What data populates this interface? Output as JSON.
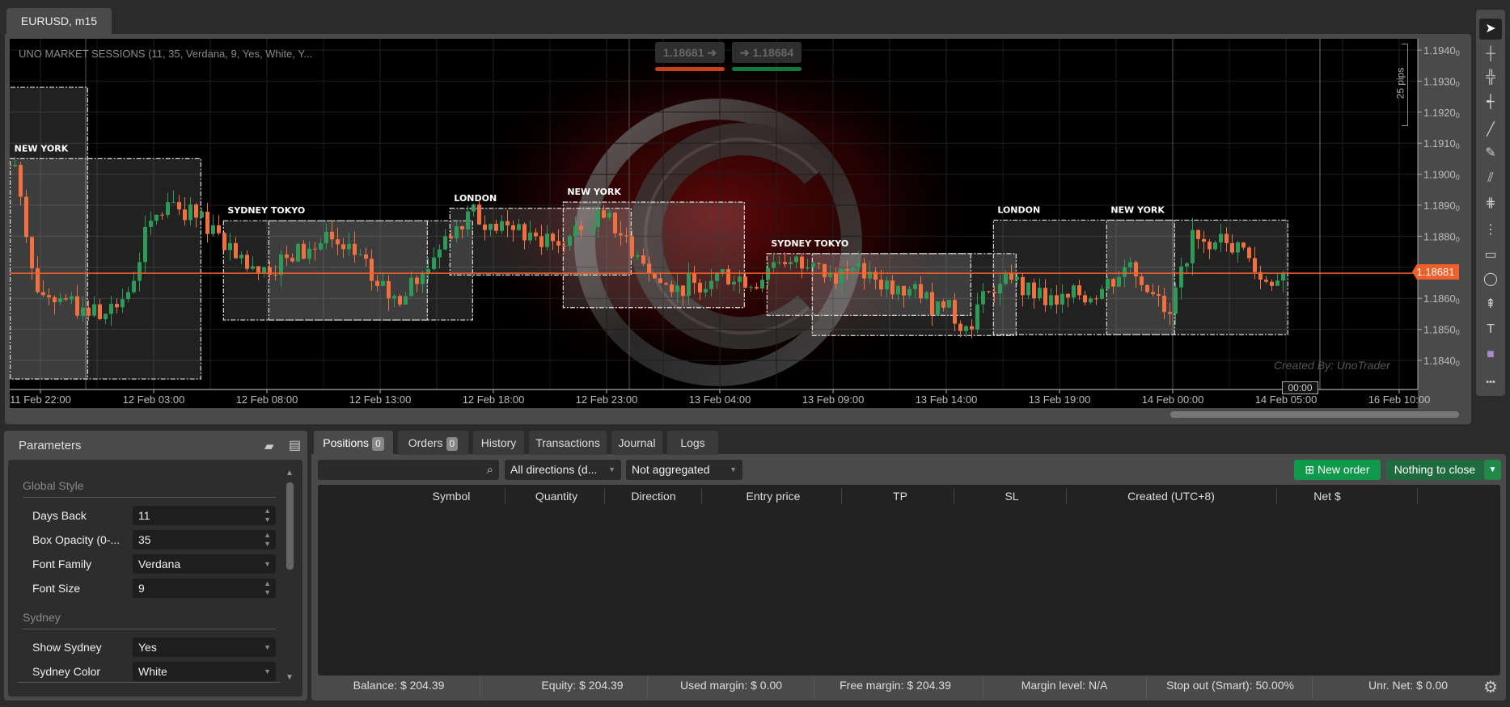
{
  "window_tab": "EURUSD, m15",
  "chart": {
    "indicator_title": "UNO MARKET SESSIONS (11, 35, Verdana, 9, Yes, White, Y...",
    "bid": "1.18681",
    "ask": "1.18684",
    "current_price_tag": "1.18681",
    "ruler_label": "25 pips",
    "watermark_text": "Created By: UnoTrader",
    "candle_timer": "00:00",
    "colors": {
      "bull": "#2f9a58",
      "bear": "#f07040",
      "price_line": "#f0602a",
      "bid_bar": "#c8401e",
      "ask_bar": "#0f7a3a"
    }
  },
  "chart_data": {
    "type": "candlestick",
    "symbol": "EURUSD",
    "timeframe": "m15",
    "ylim": [
      1.1835,
      1.1945
    ],
    "y_ticks": [
      "1.19400",
      "1.19300",
      "1.19200",
      "1.19100",
      "1.19000",
      "1.18900",
      "1.18800",
      "1.18700",
      "1.18600",
      "1.18500",
      "1.18400"
    ],
    "x_ticks": [
      "11 Feb 22:00",
      "12 Feb 03:00",
      "12 Feb 08:00",
      "12 Feb 13:00",
      "12 Feb 18:00",
      "12 Feb 23:00",
      "13 Feb 04:00",
      "13 Feb 09:00",
      "13 Feb 14:00",
      "13 Feb 19:00",
      "14 Feb 00:00",
      "14 Feb 05:00",
      "16 Feb 10:00"
    ],
    "grid": true,
    "hourly_close_start": "11 Feb 21:00",
    "hourly_close": [
      1.1903,
      1.1862,
      1.186,
      1.1857,
      1.1855,
      1.1862,
      1.1885,
      1.1891,
      1.1886,
      1.1881,
      1.1874,
      1.187,
      1.1873,
      1.1876,
      1.1879,
      1.1874,
      1.1864,
      1.1858,
      1.1868,
      1.188,
      1.1888,
      1.1884,
      1.1882,
      1.188,
      1.1877,
      1.1882,
      1.1886,
      1.188,
      1.1868,
      1.1862,
      1.1865,
      1.1868,
      1.1867,
      1.1866,
      1.1871,
      1.187,
      1.1868,
      1.187,
      1.1866,
      1.1864,
      1.186,
      1.1857,
      1.1851,
      1.1862,
      1.1866,
      1.186,
      1.1858,
      1.1861,
      1.1863,
      1.187,
      1.1862,
      1.1855,
      1.1882,
      1.1878,
      1.1878,
      1.1866,
      1.18681
    ],
    "current_price": 1.18681,
    "sessions": [
      {
        "label": "",
        "start": "11 Feb 20:15",
        "end": "12 Feb 00:05",
        "high": 1.1928,
        "low": 1.1834
      },
      {
        "label": "NEW YORK",
        "start": "11 Feb 20:40",
        "end": "12 Feb 05:05",
        "high": 1.1905,
        "low": 1.1834
      },
      {
        "label": "SYDNEY TOKYO",
        "start": "12 Feb 06:05",
        "end": "12 Feb 15:05",
        "high": 1.1885,
        "low": 1.1853
      },
      {
        "label": "",
        "start": "12 Feb 08:05",
        "end": "12 Feb 17:05",
        "high": 1.1885,
        "low": 1.1853
      },
      {
        "label": "LONDON",
        "start": "12 Feb 16:05",
        "end": "13 Feb 00:05",
        "high": 1.1889,
        "low": 1.18675
      },
      {
        "label": "NEW YORK",
        "start": "12 Feb 21:05",
        "end": "13 Feb 05:05",
        "high": 1.1891,
        "low": 1.1857
      },
      {
        "label": "SYDNEY TOKYO",
        "start": "13 Feb 06:05",
        "end": "13 Feb 15:05",
        "high": 1.18744,
        "low": 1.18545
      },
      {
        "label": "",
        "start": "13 Feb 08:05",
        "end": "13 Feb 17:05",
        "high": 1.18744,
        "low": 1.1848
      },
      {
        "label": "LONDON",
        "start": "13 Feb 16:05",
        "end": "14 Feb 00:05",
        "high": 1.18852,
        "low": 1.18483
      },
      {
        "label": "NEW YORK",
        "start": "13 Feb 21:05",
        "end": "14 Feb 05:05",
        "high": 1.18852,
        "low": 1.18483
      }
    ],
    "day_separators": [
      "12 Feb 00:00",
      "13 Feb 00:00",
      "14 Feb 00:00"
    ],
    "current_time_line": "14 Feb 06:30"
  },
  "toolbar": [
    "cursor-icon",
    "crosshair-icon",
    "crosshair-magnet-icon",
    "add-point-icon",
    "trendline-icon",
    "pencil-icon",
    "fibonacci-expansion-icon",
    "channel-icon",
    "fibonacci-icon",
    "rectangle-icon",
    "ellipse-icon",
    "price-range-icon",
    "text-icon",
    "color-swatch-icon",
    "more-icon"
  ],
  "toolbar_glyphs": [
    "➤",
    "┼",
    "╬",
    "┽",
    "╱",
    "✎",
    "⫽",
    "⋕",
    "⋮",
    "▭",
    "◯",
    "⇞",
    "T",
    "■",
    "•••"
  ],
  "parameters": {
    "title": "Parameters",
    "groups": [
      {
        "name": "Global Style",
        "rows": [
          {
            "label": "Days Back",
            "value": "11",
            "kind": "number"
          },
          {
            "label": "Box Opacity (0-...",
            "value": "35",
            "kind": "number"
          },
          {
            "label": "Font Family",
            "value": "Verdana",
            "kind": "select"
          },
          {
            "label": "Font Size",
            "value": "9",
            "kind": "number"
          }
        ]
      },
      {
        "name": "Sydney",
        "rows": [
          {
            "label": "Show Sydney",
            "value": "Yes",
            "kind": "select"
          },
          {
            "label": "Sydney Color",
            "value": "White",
            "kind": "select"
          }
        ]
      }
    ]
  },
  "bottom": {
    "tabs": [
      {
        "label": "Positions",
        "badge": "0"
      },
      {
        "label": "Orders",
        "badge": "0"
      },
      {
        "label": "History"
      },
      {
        "label": "Transactions"
      },
      {
        "label": "Journal"
      },
      {
        "label": "Logs"
      }
    ],
    "search_value": "",
    "direction_filter": "All directions (d...",
    "aggregation_filter": "Not aggregated",
    "new_order": "New order",
    "close_button": "Nothing to close",
    "columns": [
      "Symbol",
      "Quantity",
      "Direction",
      "Entry price",
      "TP",
      "SL",
      "Created (UTC+8)",
      "Net $"
    ],
    "footer": [
      {
        "label": "Balance:",
        "value": "$ 204.39"
      },
      {
        "label": "Equity:",
        "value": "$ 204.39"
      },
      {
        "label": "Used margin:",
        "value": "$ 0.00"
      },
      {
        "label": "Free margin:",
        "value": "$ 204.39"
      },
      {
        "label": "Margin level:",
        "value": "N/A"
      },
      {
        "label": "Stop out (Smart):",
        "value": "50.00%"
      },
      {
        "label": "Unr. Net:",
        "value": "$ 0.00"
      }
    ]
  }
}
